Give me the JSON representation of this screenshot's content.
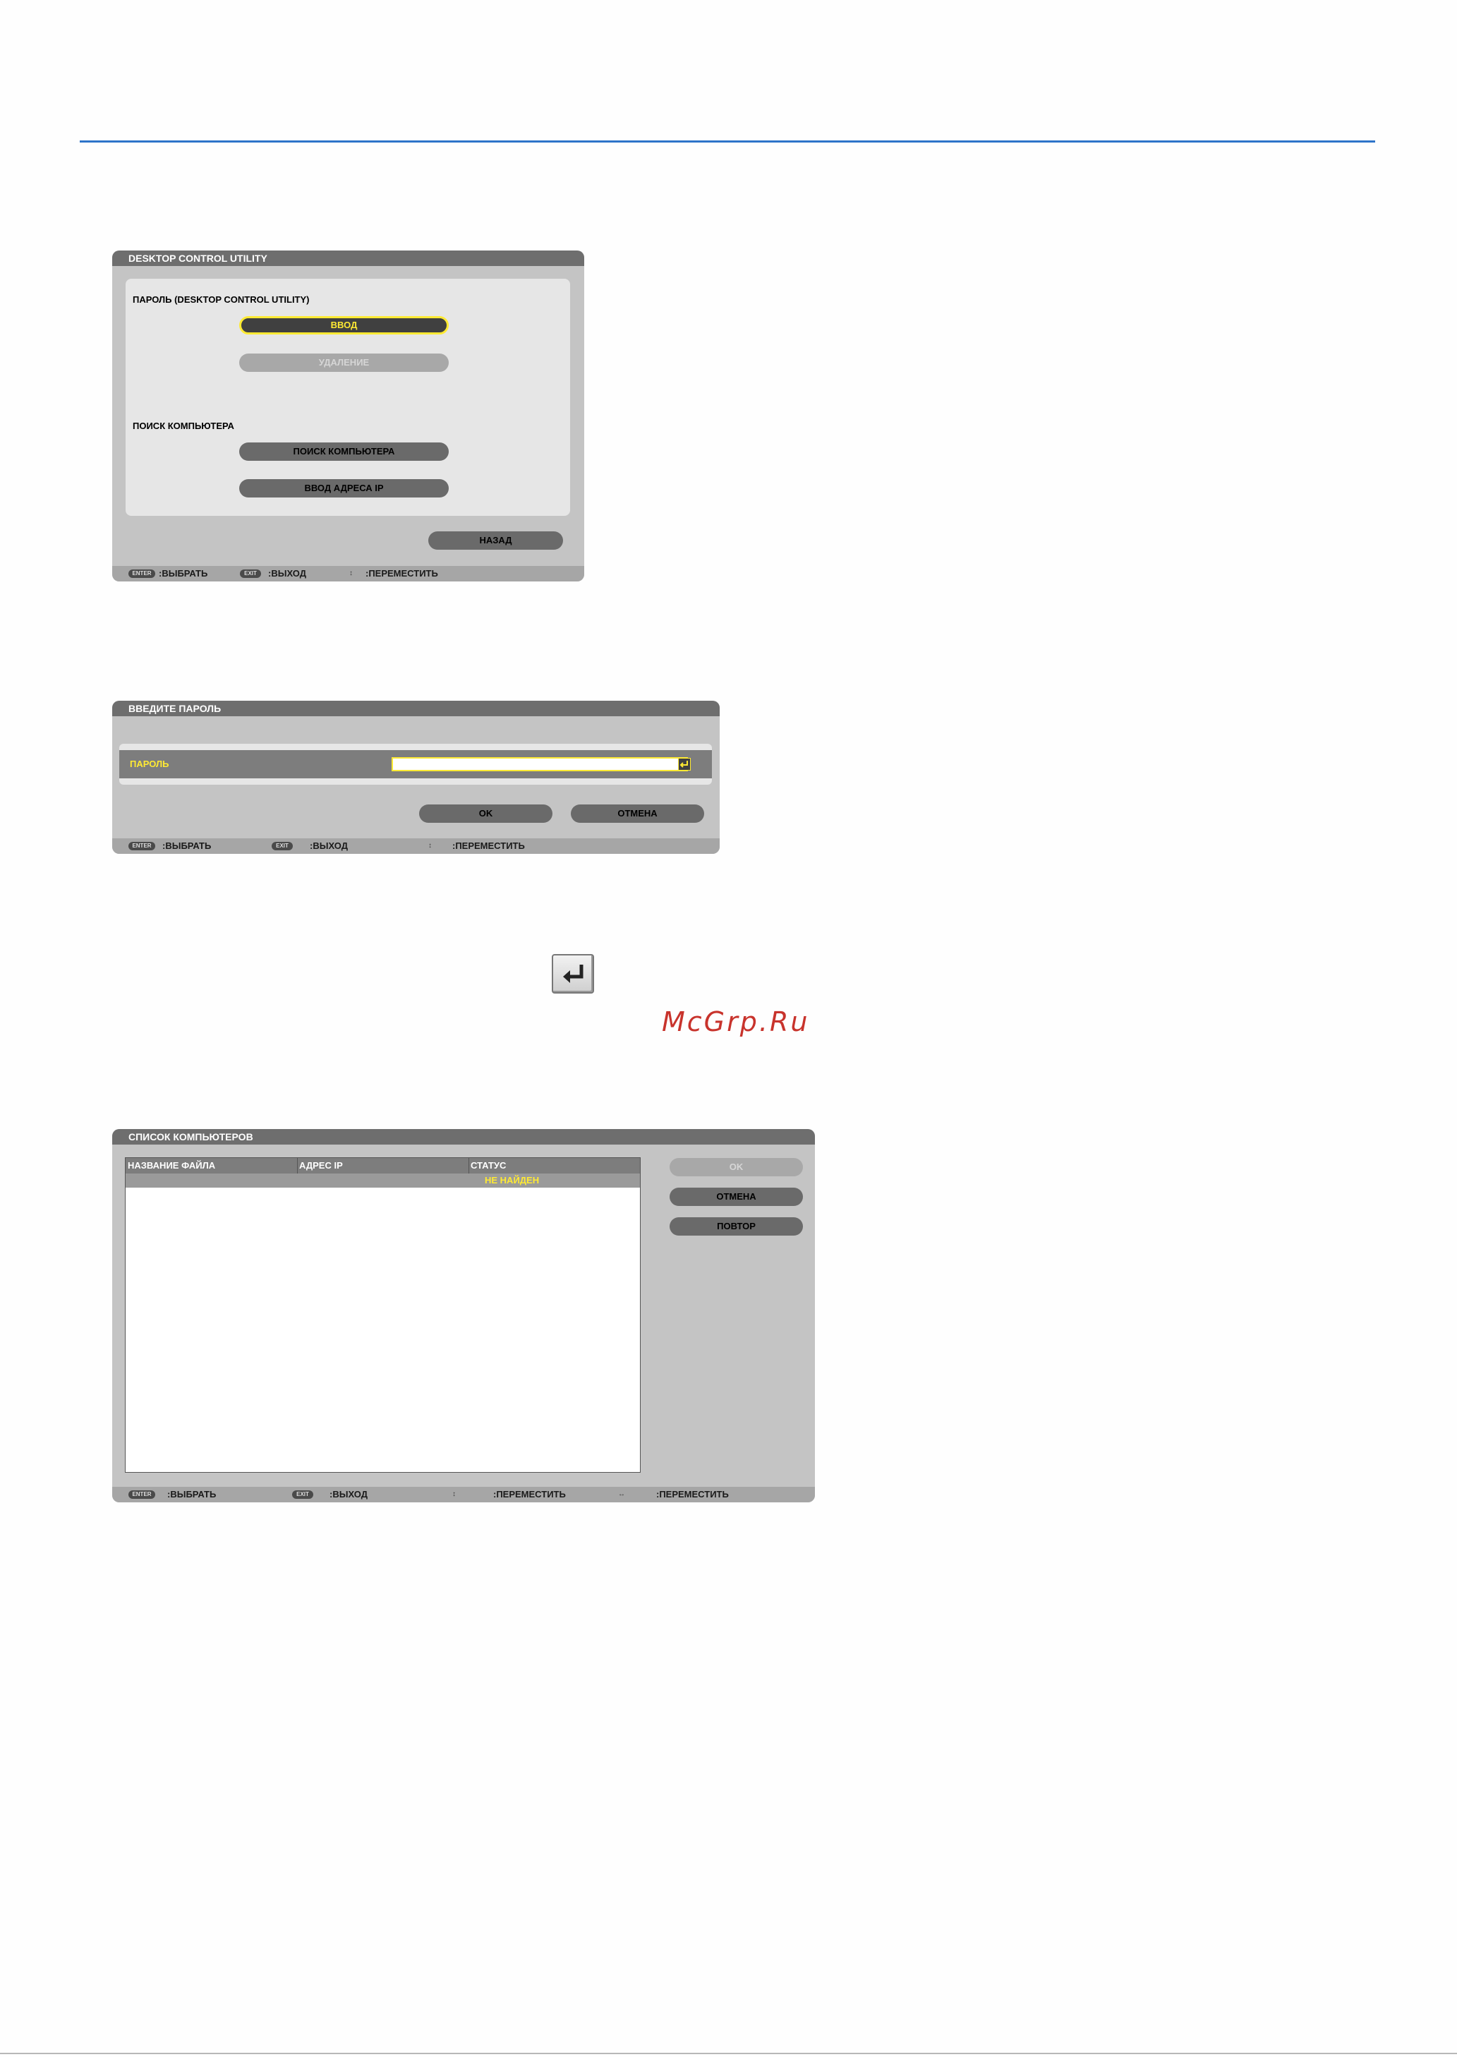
{
  "dialog1": {
    "title": "DESKTOP CONTROL UTILITY",
    "password_section_label": "ПАРОЛЬ (DESKTOP CONTROL UTILITY)",
    "enter_button": "ВВОД",
    "delete_button": "УДАЛЕНИЕ",
    "search_section_label": "ПОИСК КОМПЬЮТЕРА",
    "search_button": "ПОИСК КОМПЬЮТЕРА",
    "ip_button": "ВВОД АДРЕСА IP",
    "back_button": "НАЗАД",
    "footer": {
      "enter_key": "ENTER",
      "enter_text": ":ВЫБРАТЬ",
      "exit_key": "EXIT",
      "exit_text": ":ВЫХОД",
      "move_text": ":ПЕРЕМЕСТИТЬ"
    }
  },
  "dialog2": {
    "title": "ВВЕДИТЕ ПАРОЛЬ",
    "password_label": "ПАРОЛЬ",
    "password_value": "",
    "ok_button": "OK",
    "cancel_button": "ОТМЕНА",
    "footer": {
      "enter_key": "ENTER",
      "enter_text": ":ВЫБРАТЬ",
      "exit_key": "EXIT",
      "exit_text": ":ВЫХОД",
      "move_text": ":ПЕРЕМЕСТИТЬ"
    }
  },
  "enter_key_icon": "return-arrow-icon",
  "watermark": "McGrp.Ru",
  "dialog3": {
    "title": "СПИСОК КОМПЬЮТЕРОВ",
    "columns": [
      "НАЗВАНИЕ ФАЙЛА",
      "АДРЕС IP",
      "СТАТУС"
    ],
    "rows": [
      {
        "name": "",
        "ip": "",
        "status": "НЕ НАЙДЕН"
      }
    ],
    "ok_button": "OK",
    "cancel_button": "ОТМЕНА",
    "retry_button": "ПОВТОР",
    "footer": {
      "enter_key": "ENTER",
      "enter_text": ":ВЫБРАТЬ",
      "exit_key": "EXIT",
      "exit_text": ":ВЫХОД",
      "move_text": ":ПЕРЕМЕСТИТЬ",
      "move_lr_text": ":ПЕРЕМЕСТИТЬ"
    }
  },
  "colors": {
    "accent_rule": "#2e74c9",
    "highlight": "#ffea33",
    "watermark": "#c8332c"
  }
}
